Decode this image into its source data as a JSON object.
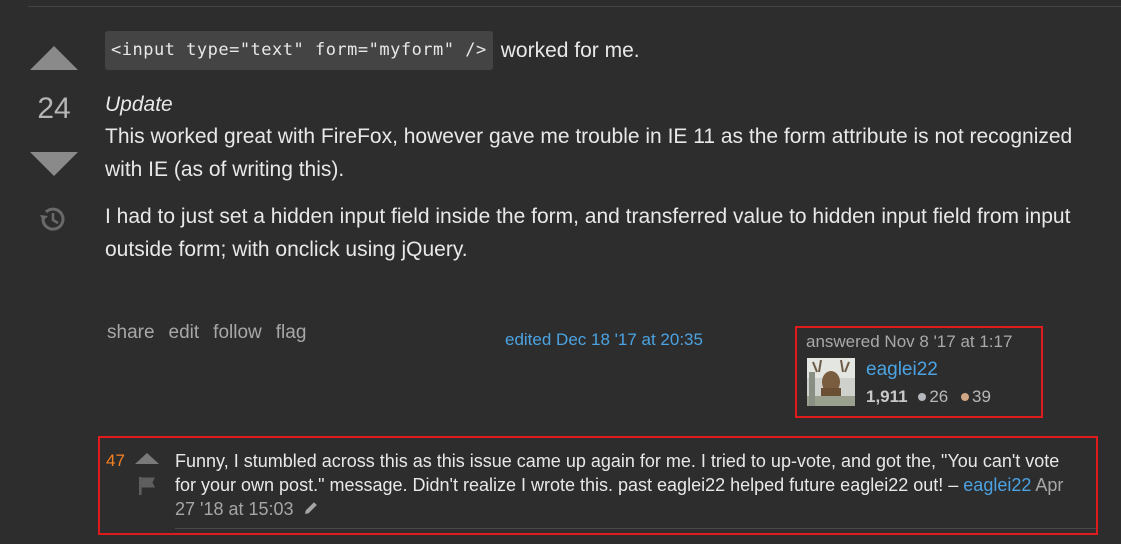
{
  "vote": {
    "count": "24"
  },
  "post": {
    "code": "<input type=\"text\" form=\"myform\" />",
    "after_code": "worked for me.",
    "update_title": "Update",
    "paragraph1": "This worked great with FireFox, however gave me trouble in IE 11 as the form attribute is not recognized with IE (as of writing this).",
    "paragraph2": "I had to just set a hidden input field inside the form, and transferred value to hidden input field from input outside form; with onclick using jQuery."
  },
  "menu": {
    "share": "share",
    "edit": "edit",
    "follow": "follow",
    "flag": "flag"
  },
  "edited": "edited Dec 18 '17 at 20:35",
  "user_card": {
    "answered": "answered Nov 8 '17 at 1:17",
    "username": "eaglei22",
    "reputation": "1,911",
    "silver_badges": "26",
    "bronze_badges": "39"
  },
  "comment": {
    "score": "47",
    "text": "Funny, I stumbled across this as this issue came up again for me. I tried to up-vote, and got the, \"You can't vote for your own post.\" message. Didn't realize I wrote this. past eaglei22 helped future eaglei22 out! – ",
    "user": "eaglei22",
    "date": "Apr 27 '18 at 15:03"
  },
  "colors": {
    "background": "#2d2d2d",
    "link": "#4ba3e3",
    "highlight_border": "#e01b1b",
    "comment_score": "#f48024"
  },
  "icons": {
    "upvote": "upvote-arrow-icon",
    "downvote": "downvote-arrow-icon",
    "history": "history-icon",
    "flag": "flag-icon",
    "edit": "pencil-icon"
  }
}
